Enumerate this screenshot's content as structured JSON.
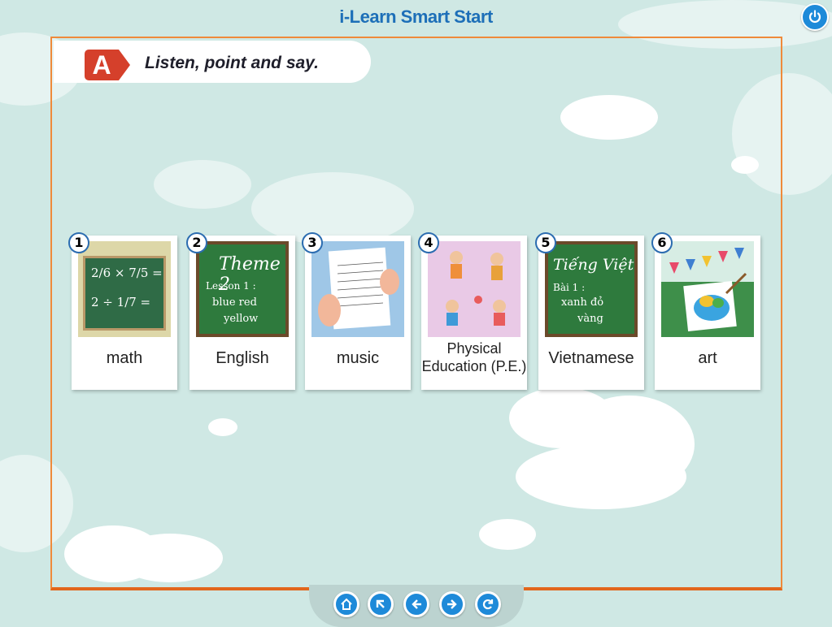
{
  "app": {
    "title": "i-Learn Smart Start"
  },
  "activity": {
    "badge": "A",
    "instruction": "Listen, point and say."
  },
  "cards": [
    {
      "number": "1",
      "label": "math",
      "chalk": [
        "2/6 × 7/5 =",
        "2 ÷ 1/7 ="
      ]
    },
    {
      "number": "2",
      "label": "English",
      "chalk_title": "Theme 2",
      "chalk_lines": [
        "Lesson 1 :",
        "blue  red",
        "yellow"
      ]
    },
    {
      "number": "3",
      "label": "music"
    },
    {
      "number": "4",
      "label_line1": "Physical",
      "label_line2": "Education (P.E.)"
    },
    {
      "number": "5",
      "label": "Vietnamese",
      "chalk_title": "Tiếng Việt",
      "chalk_lines": [
        "Bài 1 :",
        "xanh  đỏ",
        "vàng"
      ]
    },
    {
      "number": "6",
      "label": "art"
    }
  ],
  "nav": {
    "buttons": [
      "home-icon",
      "top-icon",
      "back-icon",
      "next-icon",
      "refresh-icon"
    ]
  },
  "colors": {
    "accent": "#1e8ad9",
    "badge": "#d5402b",
    "frame": "#ef8a3a",
    "board": "#2f6b46"
  }
}
